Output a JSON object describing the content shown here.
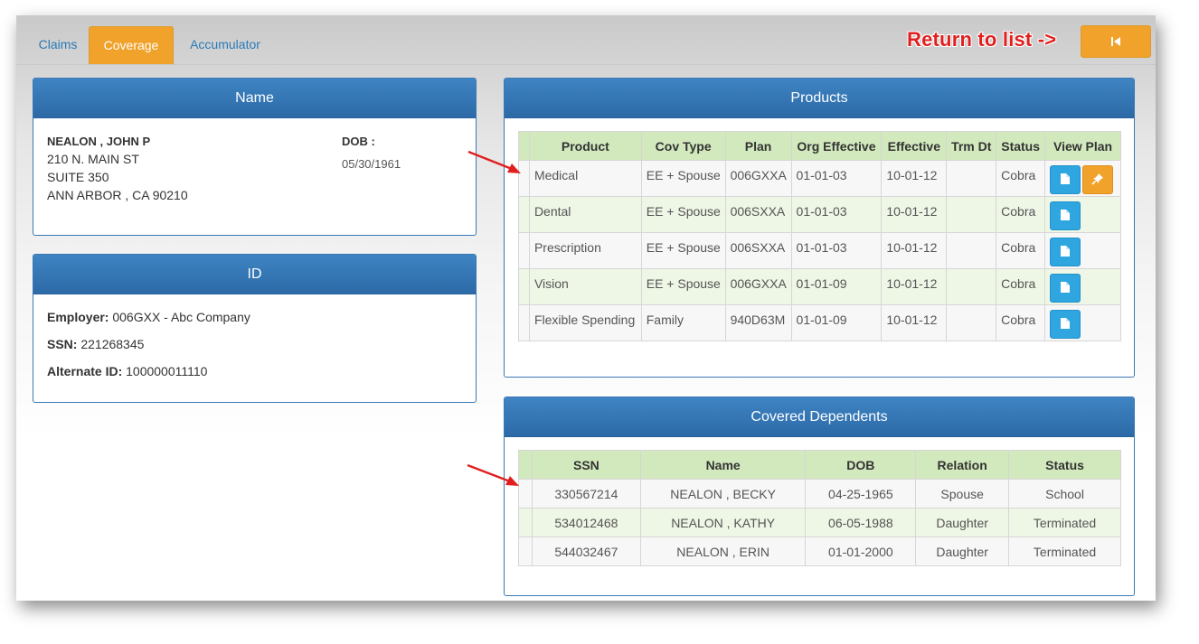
{
  "tabs": [
    {
      "label": "Claims"
    },
    {
      "label": "Coverage"
    },
    {
      "label": "Accumulator"
    }
  ],
  "return_label": "Return to list ->",
  "name_panel": {
    "title": "Name",
    "member_name": "NEALON , JOHN P",
    "address_lines": [
      "210 N. MAIN ST",
      "SUITE 350",
      "ANN ARBOR , CA 90210"
    ],
    "dob_label": "DOB :",
    "dob_value": "05/30/1961"
  },
  "id_panel": {
    "title": "ID",
    "employer_label": "Employer:",
    "employer_value": "006GXX - Abc Company",
    "ssn_label": "SSN:",
    "ssn_value": "221268345",
    "alt_label": "Alternate ID:",
    "alt_value": "100000011110"
  },
  "products_panel": {
    "title": "Products",
    "columns": [
      "Product",
      "Cov Type",
      "Plan",
      "Org Effective",
      "Effective",
      "Trm Dt",
      "Status",
      "View Plan"
    ],
    "rows": [
      {
        "product": "Medical",
        "cov_type": "EE + Spouse",
        "plan": "006GXXA",
        "org_effective": "01-01-03",
        "effective": "10-01-12",
        "trm_dt": "",
        "status": "Cobra"
      },
      {
        "product": "Dental",
        "cov_type": "EE + Spouse",
        "plan": "006SXXA",
        "org_effective": "01-01-03",
        "effective": "10-01-12",
        "trm_dt": "",
        "status": "Cobra"
      },
      {
        "product": "Prescription",
        "cov_type": "EE + Spouse",
        "plan": "006SXXA",
        "org_effective": "01-01-03",
        "effective": "10-01-12",
        "trm_dt": "",
        "status": "Cobra"
      },
      {
        "product": "Vision",
        "cov_type": "EE + Spouse",
        "plan": "006GXXA",
        "org_effective": "01-01-09",
        "effective": "10-01-12",
        "trm_dt": "",
        "status": "Cobra"
      },
      {
        "product": "Flexible Spending",
        "cov_type": "Family",
        "plan": "940D63M",
        "org_effective": "01-01-09",
        "effective": "10-01-12",
        "trm_dt": "",
        "status": "Cobra"
      }
    ]
  },
  "dependents_panel": {
    "title": "Covered Dependents",
    "columns": [
      "SSN",
      "Name",
      "DOB",
      "Relation",
      "Status"
    ],
    "rows": [
      {
        "ssn": "330567214",
        "name": "NEALON , BECKY",
        "dob": "04-25-1965",
        "relation": "Spouse",
        "status": "School"
      },
      {
        "ssn": "534012468",
        "name": "NEALON , KATHY",
        "dob": "06-05-1988",
        "relation": "Daughter",
        "status": "Terminated"
      },
      {
        "ssn": "544032467",
        "name": "NEALON , ERIN",
        "dob": "01-01-2000",
        "relation": "Daughter",
        "status": "Terminated"
      }
    ]
  },
  "icons": {
    "return": "skip-back-icon",
    "view_plan": "document-icon",
    "pin": "pushpin-icon",
    "annotation": "red-arrow-icon"
  },
  "colors": {
    "accent_orange": "#f0a22a",
    "panel_header_blue": "#2f6fac",
    "table_header_green": "#d2e9bd",
    "button_blue": "#2fa6e0",
    "annotation_red": "#e02020"
  }
}
